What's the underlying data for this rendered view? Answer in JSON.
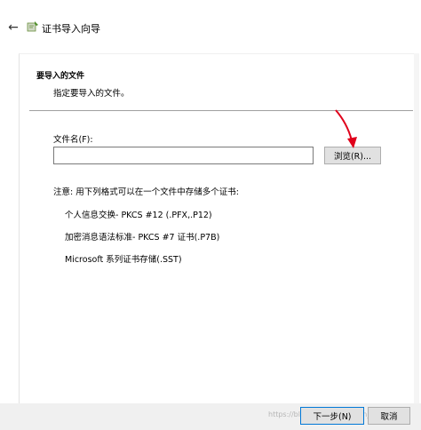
{
  "window": {
    "title": "证书导入向导",
    "back_icon": "←"
  },
  "page": {
    "section_title": "要导入的文件",
    "section_subtitle": "指定要导入的文件。",
    "file_label": "文件名(F):",
    "file_value": "",
    "browse_label": "浏览(R)...",
    "note_title": "注意: 用下列格式可以在一个文件中存储多个证书:",
    "formats": [
      "个人信息交换- PKCS #12 (.PFX,.P12)",
      "加密消息语法标准- PKCS #7 证书(.P7B)",
      "Microsoft 系列证书存储(.SST)"
    ]
  },
  "footer": {
    "next_label": "下一步(N)",
    "cancel_label": "取消"
  },
  "watermark": "https://blog.csdn.net/weixin_4530",
  "colors": {
    "annotation_arrow": "#e0001b",
    "accent": "#0078d7"
  }
}
